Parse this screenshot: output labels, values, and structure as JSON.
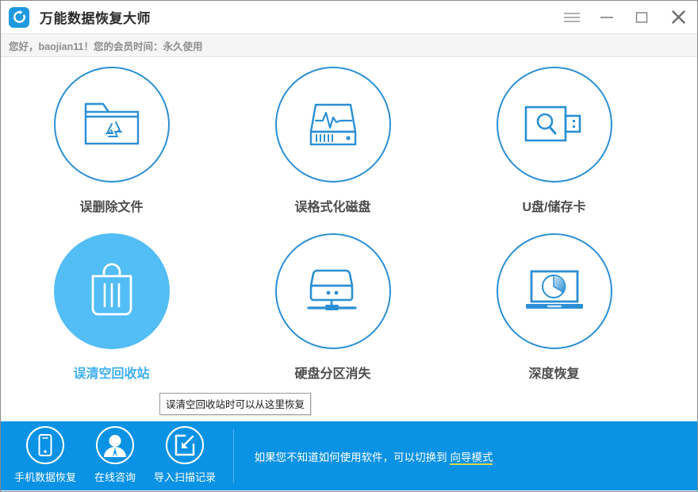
{
  "window": {
    "app_title": "万能数据恢复大师",
    "logo_icon": "recovery-refresh-icon",
    "controls": [
      {
        "name": "menu-button",
        "icon": "hamburger-menu-icon",
        "label": ""
      },
      {
        "name": "minimize-button",
        "icon": "minimize-icon",
        "label": ""
      },
      {
        "name": "maximize-button",
        "icon": "maximize-icon",
        "label": ""
      },
      {
        "name": "close-button",
        "icon": "close-icon",
        "label": ""
      }
    ]
  },
  "subheader": {
    "greeting": "您好，baojian11！您的会员时间：永久使用"
  },
  "main": {
    "items": [
      {
        "label": "误删除文件",
        "icon": "folder-recycle-icon",
        "active": false
      },
      {
        "label": "误格式化磁盘",
        "icon": "disk-waveform-icon",
        "active": false
      },
      {
        "label": "U盘/储存卡",
        "icon": "usb-search-icon",
        "active": false
      },
      {
        "label": "误清空回收站",
        "icon": "trash-bin-icon",
        "active": true
      },
      {
        "label": "硬盘分区消失",
        "icon": "hard-disk-stand-icon",
        "active": false
      },
      {
        "label": "深度恢复",
        "icon": "laptop-pie-icon",
        "active": false
      }
    ],
    "tooltip": "误清空回收站时可以从这里恢复"
  },
  "bottom": {
    "actions": [
      {
        "label": "手机数据恢复",
        "icon": "mobile-phone-icon"
      },
      {
        "label": "在线咨询",
        "icon": "user-support-icon"
      },
      {
        "label": "导入扫描记录",
        "icon": "import-arrow-icon"
      }
    ],
    "hint_prefix": "如果您不知道如何使用软件，可以切换到 ",
    "hint_link": "向导模式"
  },
  "colors": {
    "brand_blue": "#0a92e4",
    "outline_blue": "#2b8fd4",
    "active_blue": "#53bdf5",
    "active_label": "#3caef0",
    "link_underline": "#d8d84a"
  }
}
